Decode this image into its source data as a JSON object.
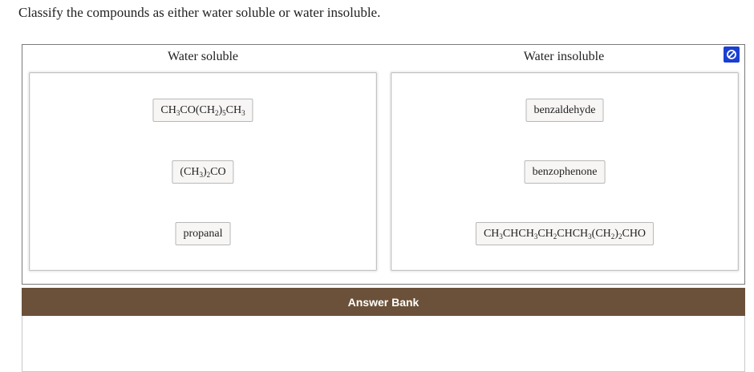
{
  "question": "Classify the compounds as either water soluble or water insoluble.",
  "columns": [
    {
      "title": "Water soluble",
      "items": [
        {
          "text": "",
          "parts": [
            [
              "CH",
              "3"
            ],
            [
              "CO(CH",
              "2"
            ],
            [
              ")",
              "5"
            ],
            [
              "CH",
              "3"
            ]
          ]
        },
        {
          "text": "",
          "parts": [
            [
              "(CH",
              "3"
            ],
            [
              ")",
              "2"
            ],
            [
              "CO",
              ""
            ]
          ]
        },
        {
          "text": "propanal"
        }
      ]
    },
    {
      "title": "Water insoluble",
      "items": [
        {
          "text": "benzaldehyde"
        },
        {
          "text": "benzophenone"
        },
        {
          "text": "",
          "parts": [
            [
              "CH",
              "3"
            ],
            [
              "CHCH",
              "3"
            ],
            [
              "CH",
              "2"
            ],
            [
              "CHCH",
              "3"
            ],
            [
              "(CH",
              "2"
            ],
            [
              ")",
              "2"
            ],
            [
              "CHO",
              ""
            ]
          ]
        }
      ]
    }
  ],
  "reset_icon": "reset-icon",
  "answer_bank": {
    "label": "Answer Bank"
  },
  "colors": {
    "accent": "#1a3fd1",
    "answer_bar": "#6b513a"
  }
}
